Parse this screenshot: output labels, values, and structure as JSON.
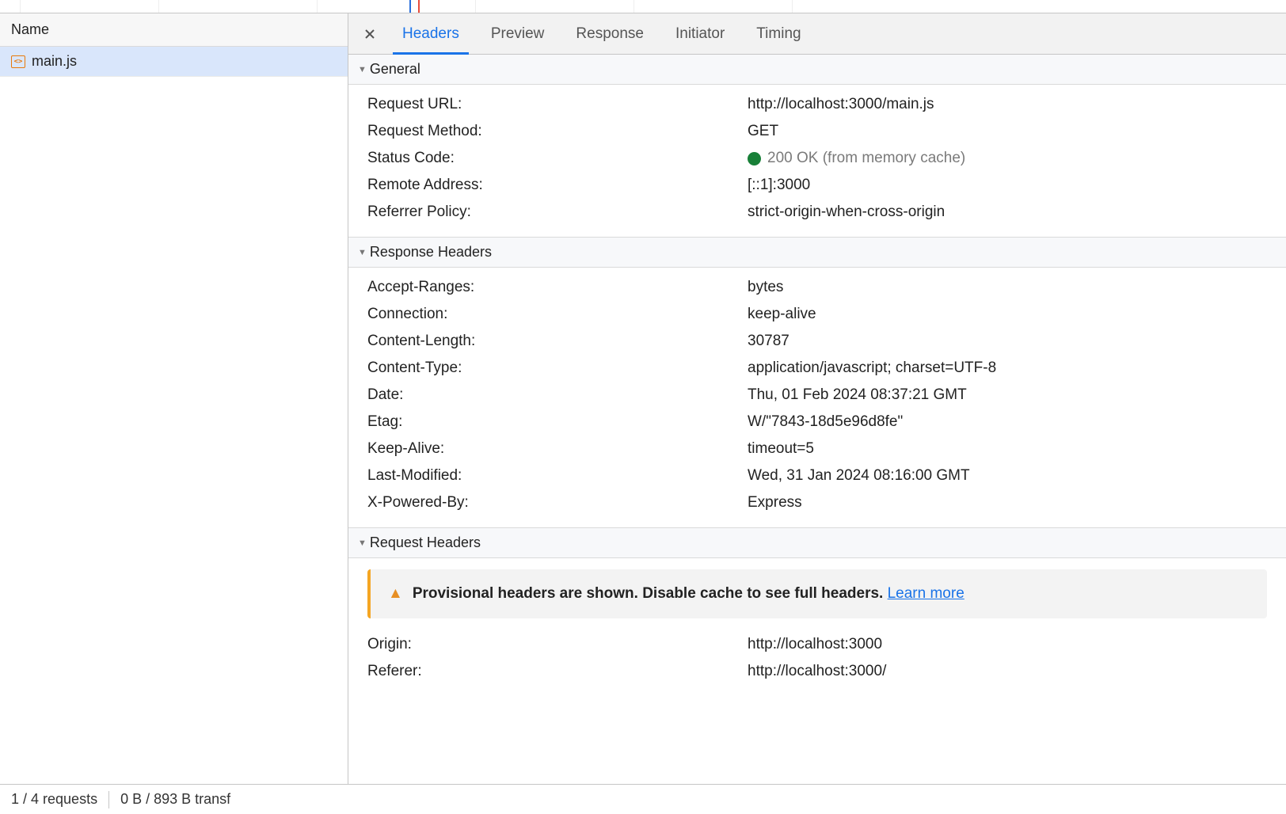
{
  "sidebar": {
    "header": "Name",
    "items": [
      {
        "filename": "main.js"
      }
    ]
  },
  "tabs": {
    "headers": "Headers",
    "preview": "Preview",
    "response": "Response",
    "initiator": "Initiator",
    "timing": "Timing"
  },
  "sections": {
    "general": {
      "title": "General",
      "rows": {
        "request_url": {
          "label": "Request URL:",
          "value": "http://localhost:3000/main.js"
        },
        "request_method": {
          "label": "Request Method:",
          "value": "GET"
        },
        "status_code": {
          "label": "Status Code:",
          "value": "200 OK (from memory cache)"
        },
        "remote_address": {
          "label": "Remote Address:",
          "value": "[::1]:3000"
        },
        "referrer_policy": {
          "label": "Referrer Policy:",
          "value": "strict-origin-when-cross-origin"
        }
      }
    },
    "response_headers": {
      "title": "Response Headers",
      "rows": {
        "accept_ranges": {
          "label": "Accept-Ranges:",
          "value": "bytes"
        },
        "connection": {
          "label": "Connection:",
          "value": "keep-alive"
        },
        "content_length": {
          "label": "Content-Length:",
          "value": "30787"
        },
        "content_type": {
          "label": "Content-Type:",
          "value": "application/javascript; charset=UTF-8"
        },
        "date": {
          "label": "Date:",
          "value": "Thu, 01 Feb 2024 08:37:21 GMT"
        },
        "etag": {
          "label": "Etag:",
          "value": "W/\"7843-18d5e96d8fe\""
        },
        "keep_alive": {
          "label": "Keep-Alive:",
          "value": "timeout=5"
        },
        "last_modified": {
          "label": "Last-Modified:",
          "value": "Wed, 31 Jan 2024 08:16:00 GMT"
        },
        "x_powered_by": {
          "label": "X-Powered-By:",
          "value": "Express"
        }
      }
    },
    "request_headers": {
      "title": "Request Headers",
      "warning": {
        "text": "Provisional headers are shown. Disable cache to see full headers.",
        "link": "Learn more"
      },
      "rows": {
        "origin": {
          "label": "Origin:",
          "value": "http://localhost:3000"
        },
        "referer": {
          "label": "Referer:",
          "value": "http://localhost:3000/"
        }
      }
    }
  },
  "statusbar": {
    "requests": "1 / 4 requests",
    "transfer": "0 B / 893 B transf"
  }
}
